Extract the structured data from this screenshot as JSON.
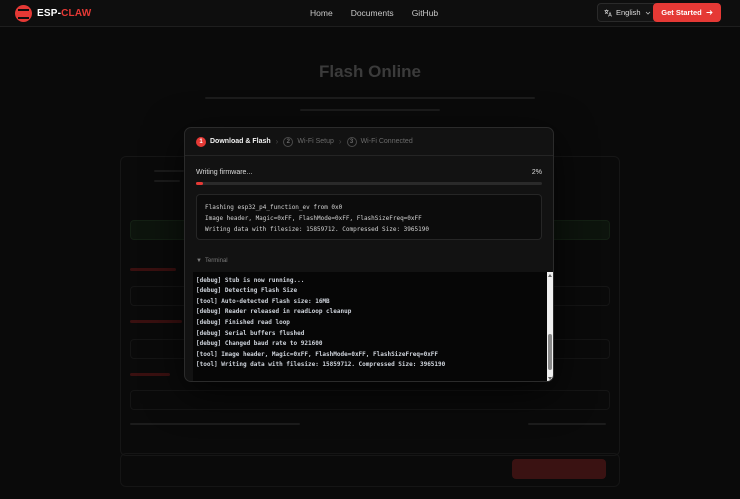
{
  "nav": {
    "logo_prefix": "ESP-",
    "logo_suffix": "CLAW",
    "links": [
      "Home",
      "Documents",
      "GitHub"
    ],
    "language": "English",
    "get_started": "Get Started"
  },
  "background": {
    "title": "Flash Online"
  },
  "modal": {
    "steps": [
      {
        "num": "1",
        "label": "Download & Flash"
      },
      {
        "num": "2",
        "label": "Wi-Fi Setup"
      },
      {
        "num": "3",
        "label": "Wi-Fi Connected"
      }
    ],
    "status": "Writing firmware...",
    "progress_text": "2%",
    "progress_value": 2,
    "log_lines": [
      "Flashing esp32_p4_function_ev from 0x0",
      "Image header, Magic=0xFF, FlashMode=0xFF, FlashSizeFreq=0xFF",
      "Writing data with filesize: 15859712. Compressed Size: 3965190"
    ],
    "terminal_label": "Terminal",
    "terminal_lines": [
      "[debug] Stub is now running...",
      "[debug] Detecting Flash Size",
      "[tool] Auto-detected Flash size: 16MB",
      "[debug] Reader released in readLoop cleanup",
      "[debug] Finished read loop",
      "[debug] Serial buffers flushed",
      "[debug] Changed baud rate to 921600",
      "[tool] Image header, Magic=0xFF, FlashMode=0xFF, FlashSizeFreq=0xFF",
      "[tool] Writing data with filesize: 15859712. Compressed Size: 3965190"
    ]
  },
  "colors": {
    "accent": "#e53935",
    "background": "#0a0a0a",
    "modal": "#121212"
  },
  "icons": [
    "translate-icon",
    "chevron-down-icon",
    "arrow-right-icon",
    "caret-down-icon"
  ]
}
